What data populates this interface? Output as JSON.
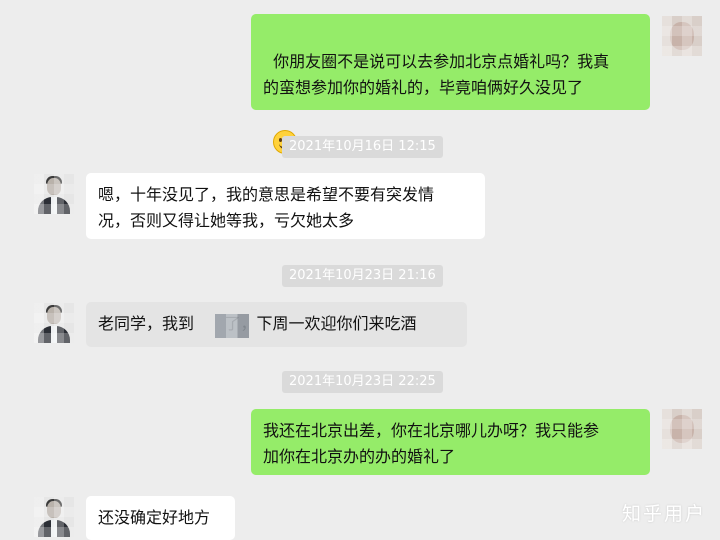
{
  "messages": [
    {
      "side": "right",
      "text": "你朋友圈不是说可以去参加北京点婚礼吗？我真\n的蛮想参加你的婚礼的，毕竟咱俩好久没见了"
    },
    {
      "timestamp": "2021年10月16日 12:15"
    },
    {
      "side": "left",
      "text": "嗯，十年没见了，我的意思是希望不要有突发情\n况，否则又得让她等我，亏欠她太多"
    },
    {
      "timestamp": "2021年10月23日 21:16"
    },
    {
      "side": "left",
      "text": "老同学，我到      了，下周一欢迎你们来吃酒"
    },
    {
      "timestamp": "2021年10月23日 22:25"
    },
    {
      "side": "right",
      "text": "我还在北京出差，你在北京哪儿办呀？我只能参\n加你在北京办的办的婚礼了"
    },
    {
      "side": "left",
      "text": "还没确定好地方"
    }
  ],
  "watermark": "知乎用户",
  "colors": {
    "background": "#ededed",
    "self_bubble": "#95ec69",
    "other_bubble": "#ffffff",
    "timestamp_bg": "#dadada"
  },
  "icons": [
    "smiley-emoji-icon",
    "avatar",
    "mosaic-redaction"
  ]
}
